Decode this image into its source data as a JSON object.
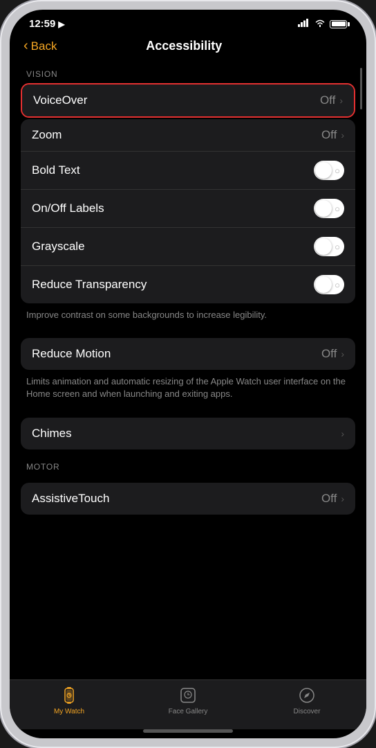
{
  "status": {
    "time": "12:59",
    "location_icon": "◀",
    "signal_bars": "▐▐▐",
    "wifi": "wifi",
    "battery": "battery"
  },
  "navigation": {
    "back_label": "Back",
    "title": "Accessibility"
  },
  "sections": {
    "vision_label": "VISION",
    "motor_label": "MOTOR"
  },
  "settings": {
    "voiceover": {
      "label": "VoiceOver",
      "value": "Off",
      "has_chevron": true,
      "highlighted": true
    },
    "zoom": {
      "label": "Zoom",
      "value": "Off",
      "has_chevron": true
    },
    "bold_text": {
      "label": "Bold Text",
      "toggle": true,
      "enabled": true
    },
    "on_off_labels": {
      "label": "On/Off Labels",
      "toggle": true,
      "enabled": true
    },
    "grayscale": {
      "label": "Grayscale",
      "toggle": true,
      "enabled": true
    },
    "reduce_transparency": {
      "label": "Reduce Transparency",
      "toggle": true,
      "enabled": true
    },
    "reduce_transparency_desc": "Improve contrast on some backgrounds to increase legibility.",
    "reduce_motion": {
      "label": "Reduce Motion",
      "value": "Off",
      "has_chevron": true
    },
    "reduce_motion_desc": "Limits animation and automatic resizing of the Apple Watch user interface on the Home screen and when launching and exiting apps.",
    "chimes": {
      "label": "Chimes",
      "has_chevron": true
    },
    "assistive_touch": {
      "label": "AssistiveTouch",
      "value": "Off",
      "has_chevron": true
    }
  },
  "tabs": {
    "my_watch": {
      "label": "My Watch",
      "active": true
    },
    "face_gallery": {
      "label": "Face Gallery",
      "active": false
    },
    "discover": {
      "label": "Discover",
      "active": false
    }
  }
}
